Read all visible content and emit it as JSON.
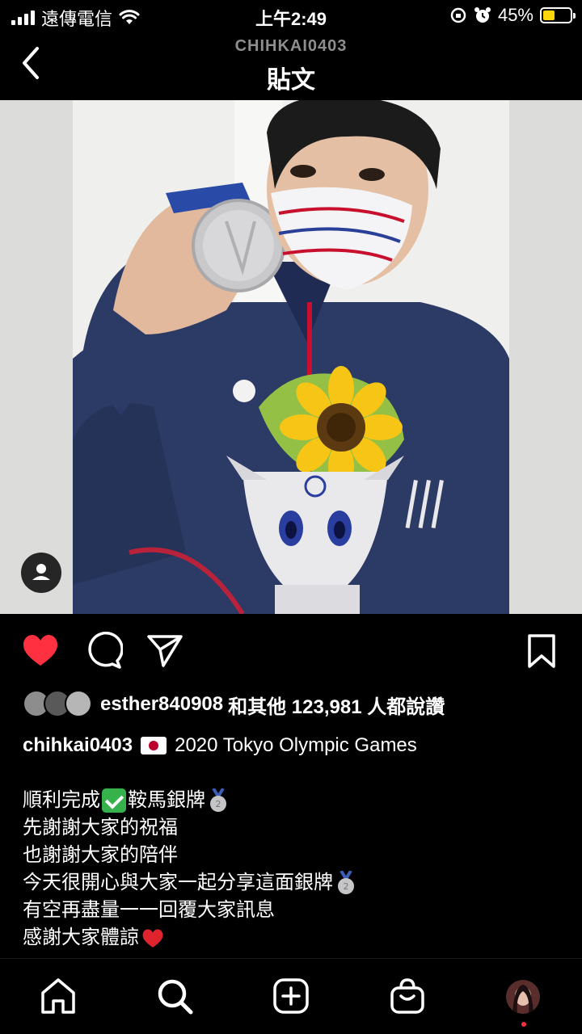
{
  "status_bar": {
    "carrier": "遠傳電信",
    "time": "上午2:49",
    "battery": "45%",
    "battery_level": 0.45
  },
  "header": {
    "username": "CHIHKAI0403",
    "title": "貼文"
  },
  "post": {
    "liked": true,
    "likes": {
      "user": "esther840908",
      "text": "和其他 123,981 人都說讚"
    },
    "caption": {
      "username": "chihkai0403",
      "headline": "2020 Tokyo Olympic Games",
      "line1_a": "順利完成",
      "line1_b": "鞍馬銀牌",
      "line2": "先謝謝大家的祝福",
      "line3": "也謝謝大家的陪伴",
      "line4": "今天很開心與大家一起分享這面銀牌",
      "line5": "有空再盡量一一回覆大家訊息",
      "line6": "感謝大家體諒"
    }
  },
  "colors": {
    "like_red": "#ff3040",
    "background": "#000000",
    "muted": "#8e8e8e",
    "battery_yellow": "#ffd60a"
  },
  "icons": {
    "back": "chevron-left-icon",
    "like": "heart-filled-icon",
    "comment": "comment-bubble-icon",
    "share": "paper-plane-icon",
    "save": "bookmark-icon",
    "tag": "person-tag-icon",
    "nav": [
      "home-icon",
      "search-icon",
      "new-post-icon",
      "shop-icon",
      "profile-avatar"
    ]
  }
}
